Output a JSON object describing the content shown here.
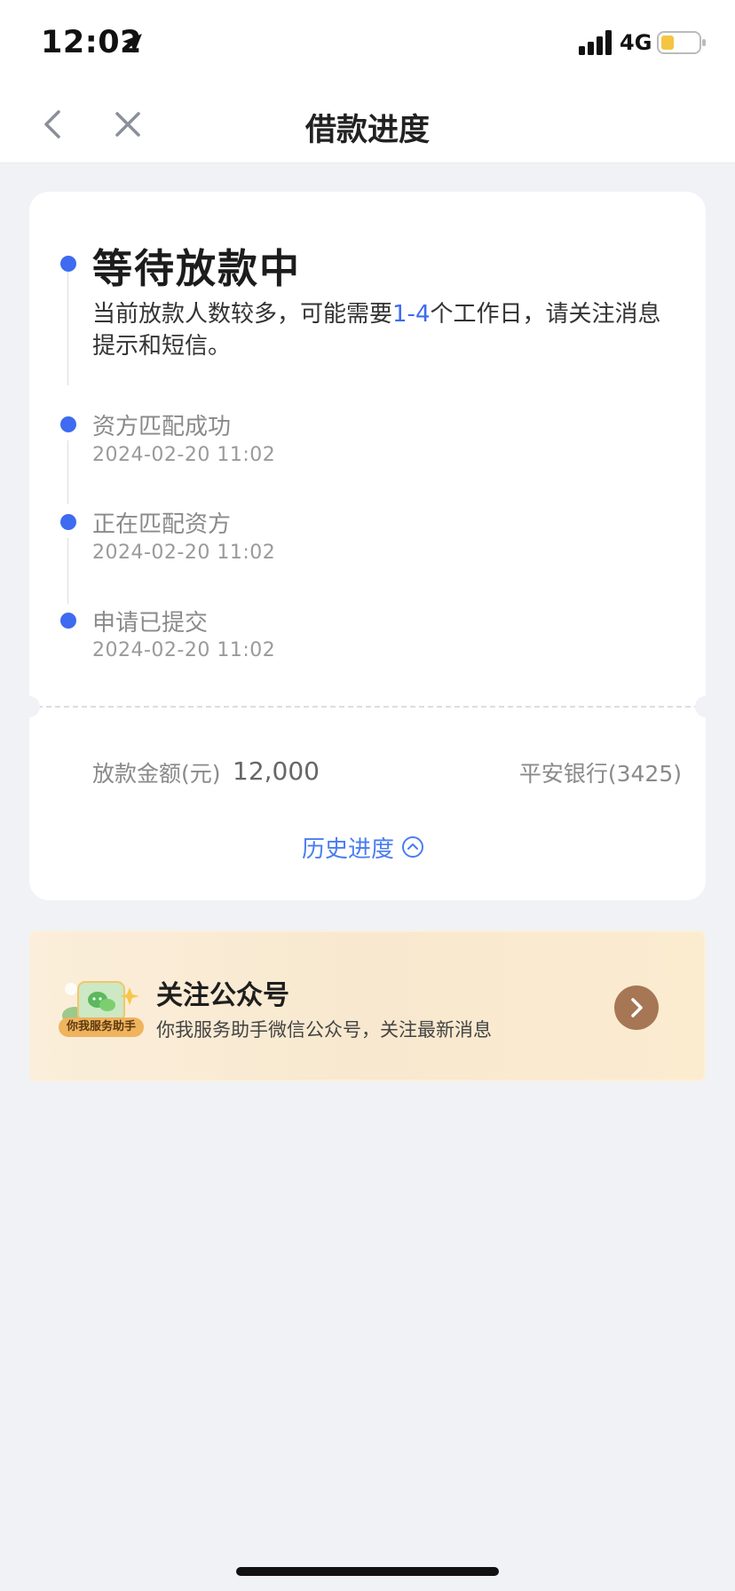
{
  "status_bar": {
    "time": "12:02",
    "network": "4G",
    "icons": [
      "location-arrow-icon",
      "signal-icon",
      "battery-icon"
    ]
  },
  "nav": {
    "title": "借款进度",
    "icons": [
      "chevron-left-icon",
      "close-icon"
    ]
  },
  "progress": {
    "current_title": "等待放款中",
    "desc_prefix": "当前放款人数较多，可能需要",
    "desc_highlight": "1-4",
    "desc_suffix": "个工作日，请关注消息提示和短信。",
    "steps": [
      {
        "label": "资方匹配成功",
        "time": "2024-02-20 11:02"
      },
      {
        "label": "正在匹配资方",
        "time": "2024-02-20 11:02"
      },
      {
        "label": "申请已提交",
        "time": "2024-02-20 11:02"
      }
    ]
  },
  "loan": {
    "amount_label": "放款金额(元)",
    "amount_value": "12,000",
    "bank": "平安银行(3425)"
  },
  "history": {
    "label": "历史进度",
    "icon": "chevron-up-circle-icon"
  },
  "follow": {
    "badge": "你我服务助手",
    "title": "关注公众号",
    "subtitle": "你我服务助手微信公众号，关注最新消息",
    "icon": "chevron-right-icon"
  },
  "colors": {
    "accent": "#3e6bef",
    "link": "#4a7df1",
    "page_bg": "#f1f2f6",
    "banner_arrow": "#a67655"
  }
}
